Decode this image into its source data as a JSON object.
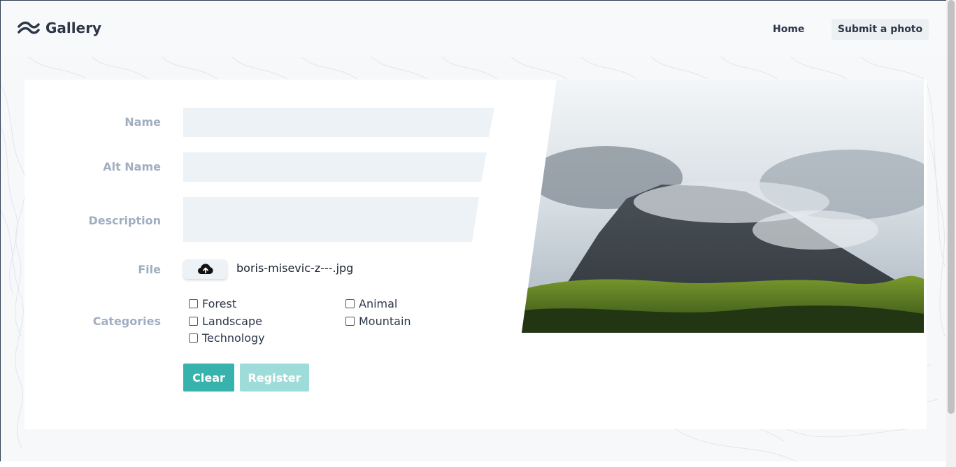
{
  "brand": {
    "name": "Gallery",
    "icon": "wave-logo-icon"
  },
  "nav": {
    "home": "Home",
    "submit": "Submit a photo"
  },
  "form": {
    "name_label": "Name",
    "alt_name_label": "Alt Name",
    "description_label": "Description",
    "file_label": "File",
    "categories_label": "Categories",
    "name_value": "",
    "alt_name_value": "",
    "description_value": "",
    "file_name": "boris-misevic-z---.jpg",
    "upload_icon": "cloud-upload-icon",
    "categories": [
      {
        "label": "Forest",
        "checked": false
      },
      {
        "label": "Animal",
        "checked": false
      },
      {
        "label": "Landscape",
        "checked": false
      },
      {
        "label": "Mountain",
        "checked": false
      },
      {
        "label": "Technology",
        "checked": false
      }
    ],
    "clear_label": "Clear",
    "register_label": "Register"
  },
  "colors": {
    "accent": "#38b2ac",
    "accent_disabled": "#9ddcd8",
    "field_bg": "#edf2f7",
    "label": "#a0aec0"
  }
}
